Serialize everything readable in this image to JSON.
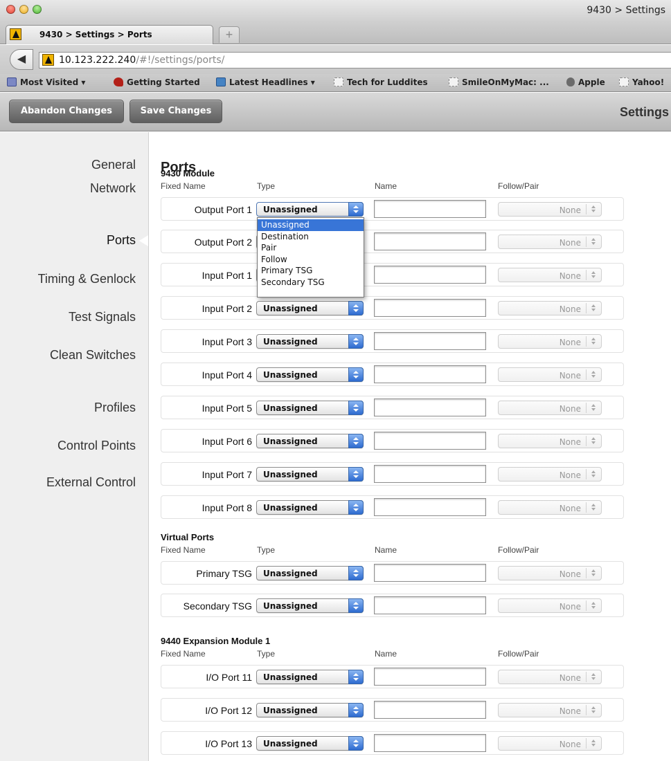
{
  "window": {
    "title": "9430 > Settings"
  },
  "tabs": [
    {
      "label": "9430 > Settings > Ports"
    }
  ],
  "new_tab_symbol": "+",
  "address_bar": {
    "host": "10.123.222.240",
    "path": "/#!/settings/ports/"
  },
  "back_symbol": "◀",
  "bookmarks": [
    "Most Visited ▾",
    "Getting Started",
    "Latest Headlines ▾",
    "Tech for Luddites",
    "SmileOnMyMac: ...",
    "Apple",
    "Yahoo!"
  ],
  "toolbar": {
    "abandon_label": "Abandon Changes",
    "save_label": "Save Changes",
    "page_title": "Settings"
  },
  "sidebar": {
    "items": [
      "General",
      "Network",
      "Ports",
      "Timing & Genlock",
      "Test Signals",
      "Clean Switches",
      "Profiles",
      "Control Points",
      "External Control"
    ],
    "active": "Ports"
  },
  "heading": "Ports",
  "columns": {
    "fixed_name": "Fixed Name",
    "type": "Type",
    "name": "Name",
    "follow_pair": "Follow/Pair"
  },
  "sections": [
    {
      "title": "9430 Module",
      "rows": [
        {
          "fixed_name": "Output Port 1",
          "type": "Unassigned",
          "follow": "None"
        },
        {
          "fixed_name": "Output Port 2",
          "type": "Unassigned",
          "follow": "None"
        },
        {
          "fixed_name": "Input Port 1",
          "type": "Unassigned",
          "follow": "None"
        },
        {
          "fixed_name": "Input Port 2",
          "type": "Unassigned",
          "follow": "None"
        },
        {
          "fixed_name": "Input Port 3",
          "type": "Unassigned",
          "follow": "None"
        },
        {
          "fixed_name": "Input Port 4",
          "type": "Unassigned",
          "follow": "None"
        },
        {
          "fixed_name": "Input Port 5",
          "type": "Unassigned",
          "follow": "None"
        },
        {
          "fixed_name": "Input Port 6",
          "type": "Unassigned",
          "follow": "None"
        },
        {
          "fixed_name": "Input Port 7",
          "type": "Unassigned",
          "follow": "None"
        },
        {
          "fixed_name": "Input Port 8",
          "type": "Unassigned",
          "follow": "None"
        }
      ]
    },
    {
      "title": "Virtual Ports",
      "rows": [
        {
          "fixed_name": "Primary TSG",
          "type": "Unassigned",
          "follow": "None"
        },
        {
          "fixed_name": "Secondary TSG",
          "type": "Unassigned",
          "follow": "None"
        }
      ]
    },
    {
      "title": "9440 Expansion Module 1",
      "rows": [
        {
          "fixed_name": "I/O Port 11",
          "type": "Unassigned",
          "follow": "None"
        },
        {
          "fixed_name": "I/O Port 12",
          "type": "Unassigned",
          "follow": "None"
        },
        {
          "fixed_name": "I/O Port 13",
          "type": "Unassigned",
          "follow": "None"
        }
      ]
    }
  ],
  "type_dropdown": {
    "open_for": "Output Port 1",
    "options": [
      "Unassigned",
      "Destination",
      "Pair",
      "Follow",
      "Primary TSG",
      "Secondary TSG"
    ],
    "highlighted": "Unassigned"
  }
}
